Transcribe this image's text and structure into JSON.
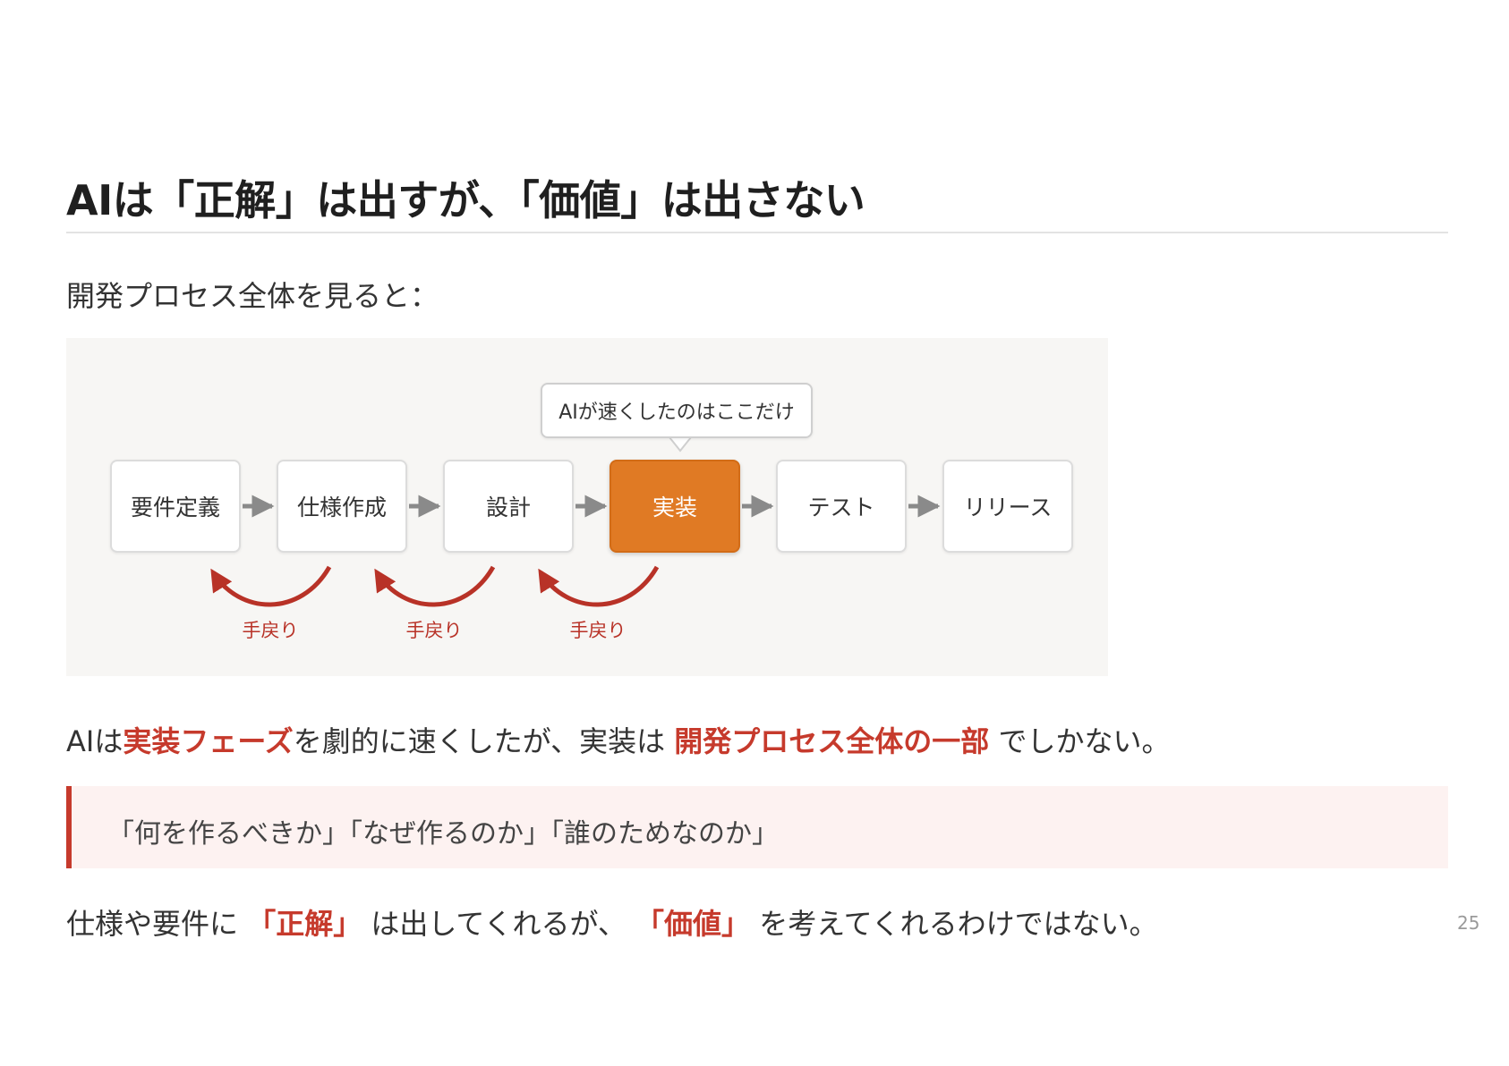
{
  "slide": {
    "title": "AIは「正解」は出すが、「価値」は出さない",
    "intro": "開発プロセス全体を見ると：",
    "page_number": "25"
  },
  "diagram": {
    "callout": "AIが速くしたのはここだけ",
    "steps": [
      "要件定義",
      "仕様作成",
      "設計",
      "実装",
      "テスト",
      "リリース"
    ],
    "active_step": "実装",
    "back_labels": [
      "手戻り",
      "手戻り",
      "手戻り"
    ],
    "colors": {
      "active": "#e07a24",
      "rework": "#b83227",
      "arrow": "#8a8a8a"
    }
  },
  "summary": {
    "prefix": "AIは",
    "hl1": "実装フェーズ",
    "mid": "を劇的に速くしたが、実装は ",
    "hl2": "開発プロセス全体の一部",
    "suffix": " でしかない。"
  },
  "quote": {
    "text": "「何を作るべきか」「なぜ作るのか」「誰のためなのか」"
  },
  "closing": {
    "prefix": "仕様や要件に ",
    "hl1": "「正解」",
    "mid": " は出してくれるが、 ",
    "hl2": "「価値」",
    "suffix": " を考えてくれるわけではない。"
  },
  "theme": {
    "accent": "#c63a2c",
    "quote_bg": "#fdf2f1"
  }
}
